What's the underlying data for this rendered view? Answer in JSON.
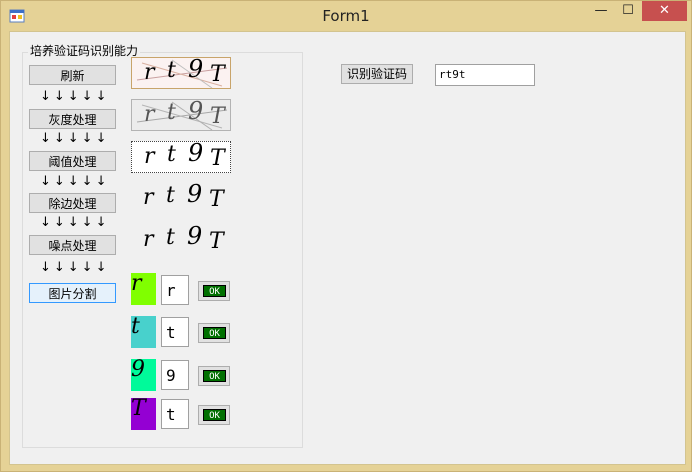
{
  "window": {
    "title": "Form1",
    "minimize_glyph": "—",
    "maximize_glyph": "☐",
    "close_glyph": "✕"
  },
  "group": {
    "title": "培养验证码识别能力"
  },
  "buttons": {
    "refresh": "刷新",
    "grayscale": "灰度处理",
    "threshold": "阈值处理",
    "remove_border": "除边处理",
    "denoise": "噪点处理",
    "split": "图片分割"
  },
  "arrows": "↓↓↓↓↓",
  "captcha_chars": [
    "r",
    "t",
    "9",
    "T"
  ],
  "segments": [
    {
      "char": "r",
      "value": "r",
      "color": "#80ff00",
      "ok": "OK"
    },
    {
      "char": "t",
      "value": "t",
      "color": "#48d1cc",
      "ok": "OK"
    },
    {
      "char": "9",
      "value": "9",
      "color": "#00fa9a",
      "ok": "OK"
    },
    {
      "char": "T",
      "value": "t",
      "color": "#9400d3",
      "ok": "OK"
    }
  ],
  "recognize_label": "识别验证码",
  "result_value": "rt9t"
}
